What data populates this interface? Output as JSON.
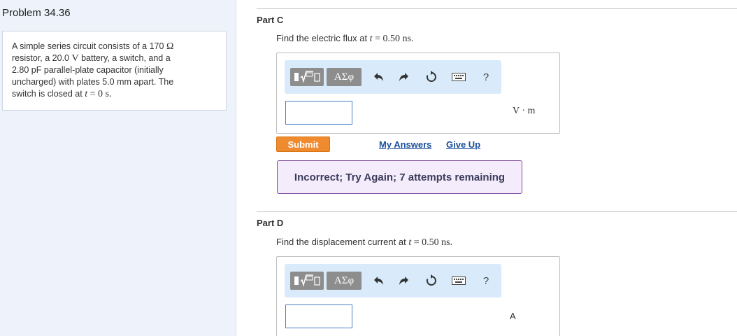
{
  "problem": {
    "title": "Problem 34.36",
    "text_lines": [
      {
        "a": "A simple series circuit consists of a 170 ",
        "b": "Ω",
        "c": ""
      },
      {
        "a": "resistor, a 20.0 ",
        "b": "V",
        "c": " battery, a switch, and a"
      },
      {
        "a": "2.80 pF parallel-plate capacitor (initially",
        "b": "",
        "c": ""
      },
      {
        "a": "uncharged) with plates 5.0 mm apart. The",
        "b": "",
        "c": ""
      }
    ],
    "last_line": {
      "a": "switch is closed at ",
      "var": "t",
      "eq": " = ",
      "val": "0 s."
    }
  },
  "parts": [
    {
      "label": "Part C",
      "question_a": "Find the electric flux at ",
      "var": "t",
      "eq": " = ",
      "val": "0.50 ns.",
      "input_value": "",
      "units": "V · m"
    },
    {
      "label": "Part D",
      "question_a": "Find the displacement current at ",
      "var": "t",
      "eq": " = ",
      "val": "0.50 ns.",
      "input_value": "",
      "units": "A"
    }
  ],
  "toolbar": {
    "symbols_label": "ΑΣφ",
    "help_label": "?"
  },
  "actions": {
    "submit_label": "Submit",
    "my_answers_label": "My Answers",
    "give_up_label": "Give Up"
  },
  "feedback": {
    "text": "Incorrect; Try Again; 7 attempts remaining"
  },
  "colors": {
    "submit": "#f08a2e",
    "link": "#1a4f9c",
    "feedback_border": "#7c4c9e",
    "toolbar_bg": "#d9ebfa"
  }
}
